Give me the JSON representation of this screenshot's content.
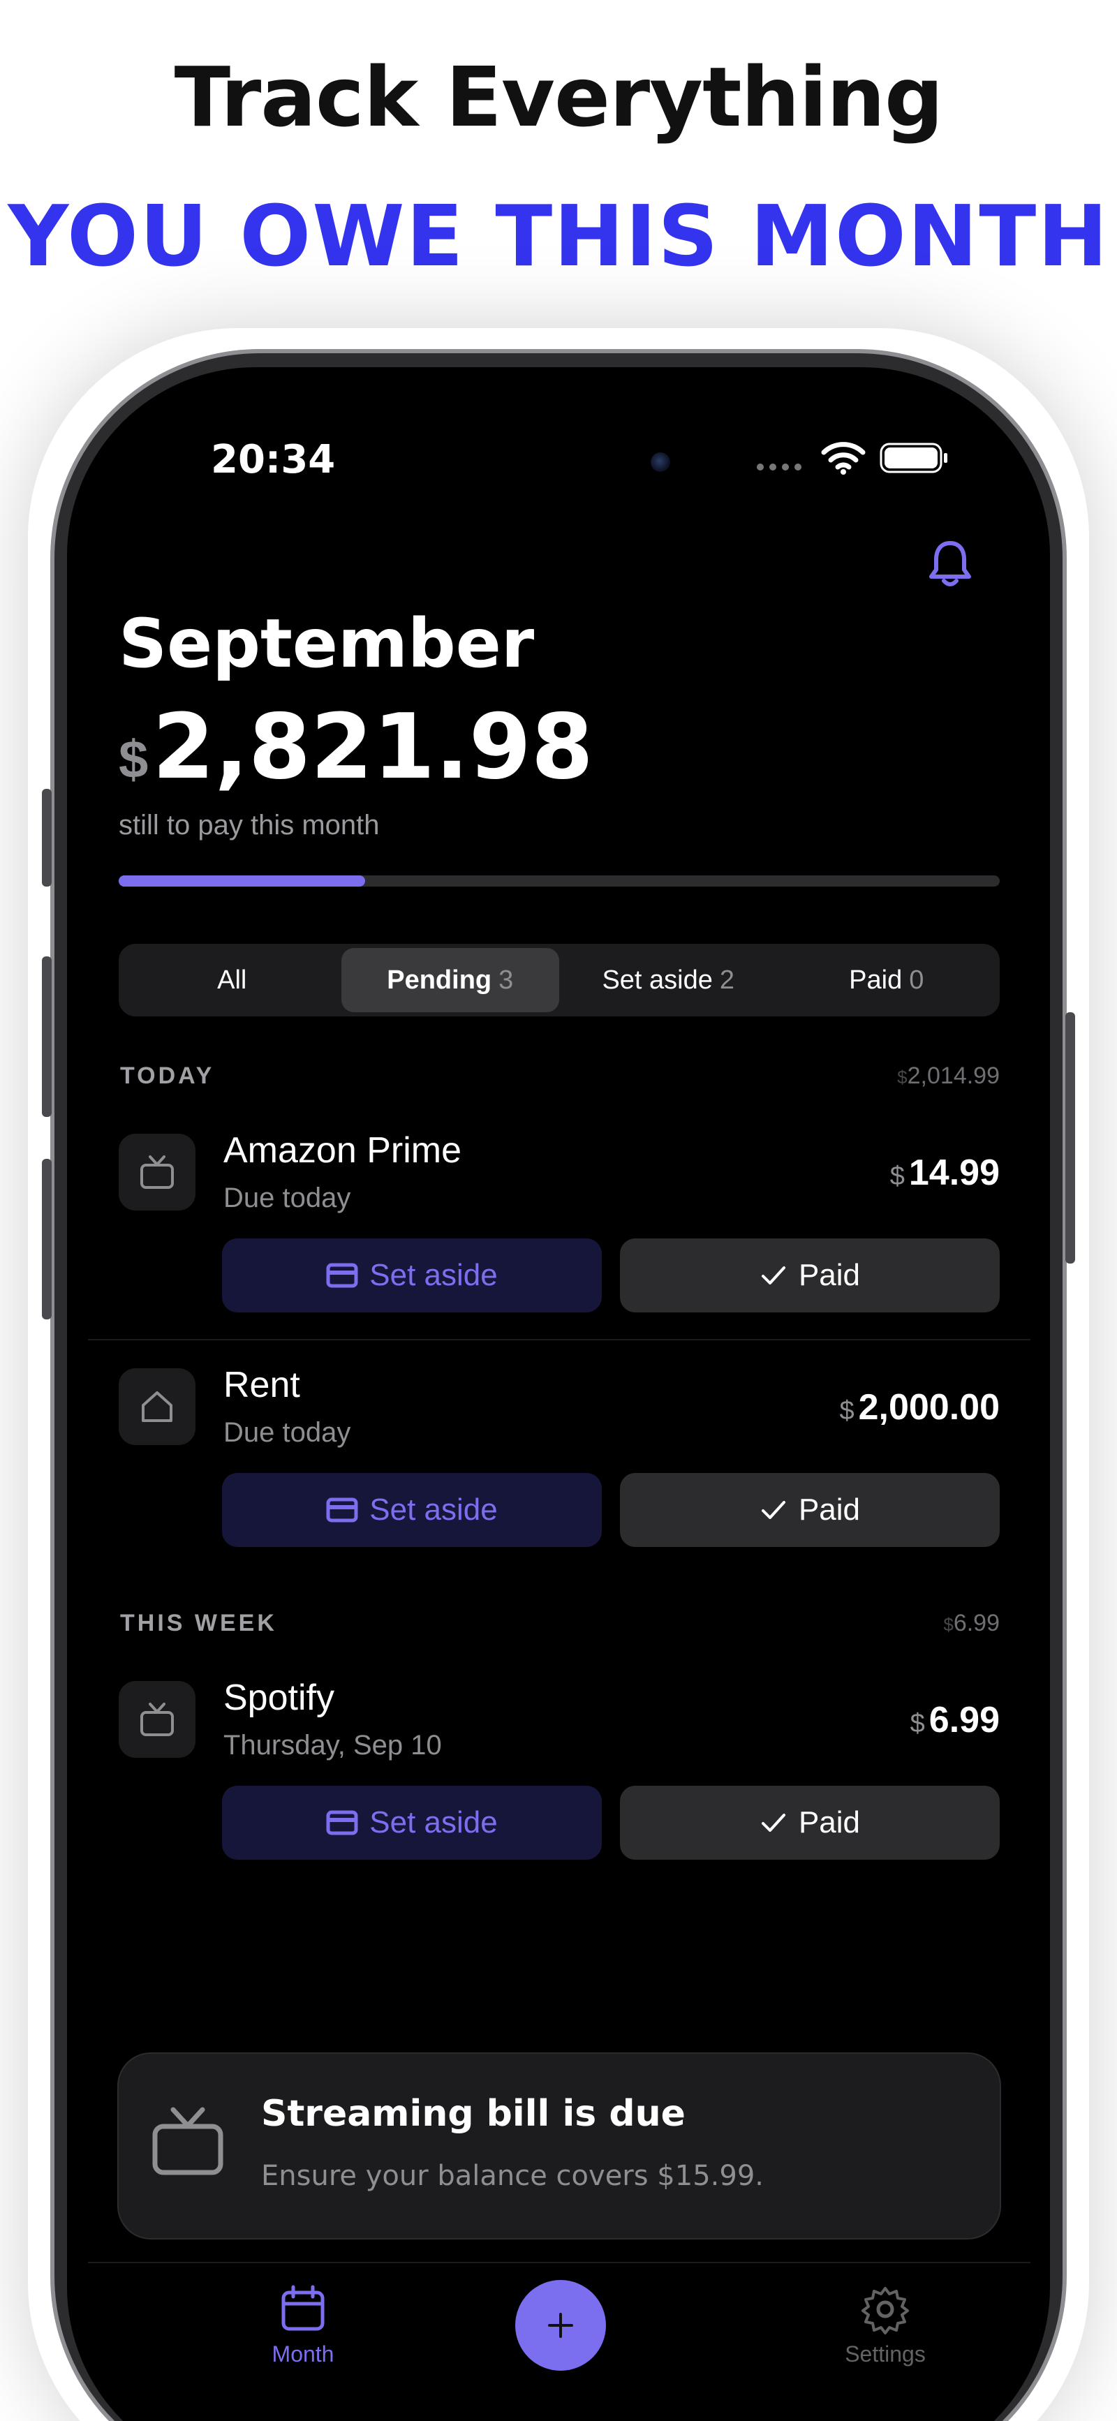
{
  "headline": {
    "title": "Track Everything",
    "subtitle": "YOU OWE THIS MONTH"
  },
  "status_bar": {
    "time": "20:34",
    "icons": [
      "signal-icon",
      "wifi-icon",
      "battery-icon"
    ]
  },
  "header": {
    "month": "September",
    "currency": "$",
    "amount": "2,821.98",
    "caption": "still to pay this month",
    "progress_fraction": 0.28,
    "accent_color": "#7b6ff0"
  },
  "filter_tabs": [
    {
      "label": "All",
      "count": "",
      "active": false
    },
    {
      "label": "Pending",
      "count": "3",
      "active": true
    },
    {
      "label": "Set aside",
      "count": "2",
      "active": false
    },
    {
      "label": "Paid",
      "count": "0",
      "active": false
    }
  ],
  "sections": {
    "today": {
      "label": "TODAY",
      "total_currency": "$",
      "total": "2,014.99"
    },
    "this_week": {
      "label": "THIS WEEK",
      "total_currency": "$",
      "total": "6.99"
    }
  },
  "bills": {
    "amazon": {
      "name": "Amazon Prime",
      "due": "Due today",
      "currency": "$",
      "amount": "14.99",
      "icon": "tv-icon"
    },
    "rent": {
      "name": "Rent",
      "due": "Due today",
      "currency": "$",
      "amount": "2,000.00",
      "icon": "house-icon"
    },
    "spotify": {
      "name": "Spotify",
      "due": "Thursday, Sep 10",
      "currency": "$",
      "amount": "6.99",
      "icon": "tv-icon"
    }
  },
  "actions": {
    "set_aside": "Set aside",
    "paid": "Paid"
  },
  "notification": {
    "title": "Streaming bill is due",
    "body": "Ensure your balance covers $15.99."
  },
  "tabbar": {
    "month": "Month",
    "settings": "Settings"
  }
}
